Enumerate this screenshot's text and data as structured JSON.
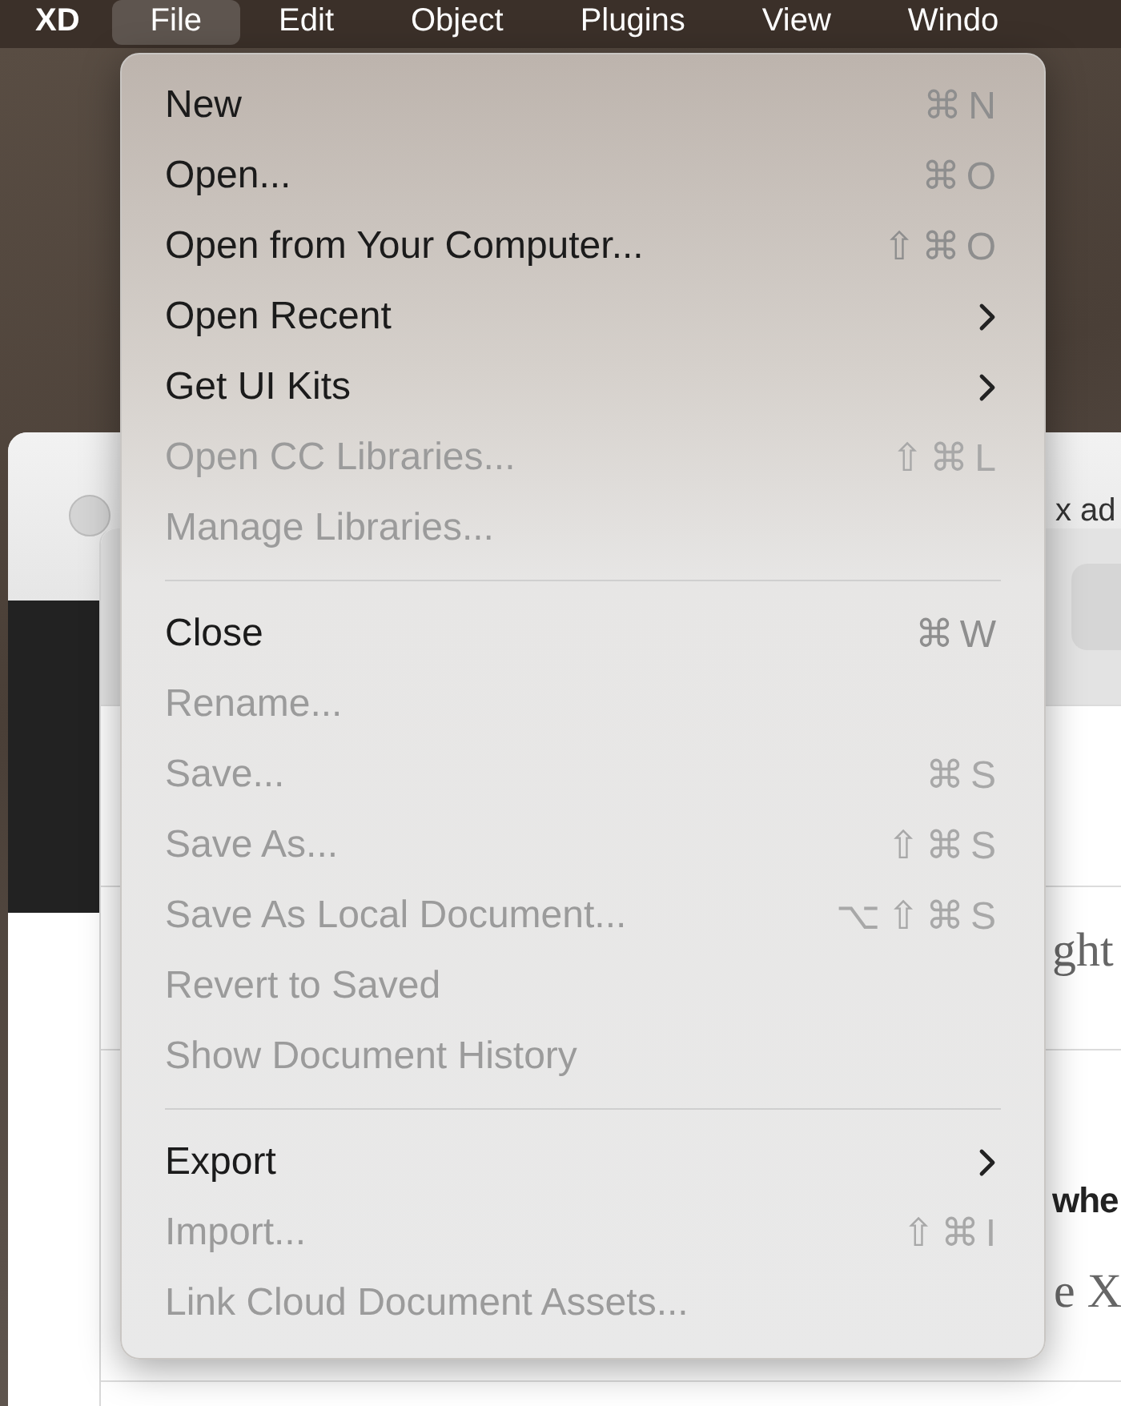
{
  "menu_bar": [
    {
      "label": "XD",
      "selected": false,
      "kind": "app"
    },
    {
      "label": "File",
      "selected": true,
      "kind": "menu"
    },
    {
      "label": "Edit",
      "selected": false,
      "kind": "menu"
    },
    {
      "label": "Object",
      "selected": false,
      "kind": "menu"
    },
    {
      "label": "Plugins",
      "selected": false,
      "kind": "menu"
    },
    {
      "label": "View",
      "selected": false,
      "kind": "menu"
    },
    {
      "label": "Windo",
      "selected": false,
      "kind": "menu"
    }
  ],
  "background_window": {
    "texts": [
      {
        "text": "x ad",
        "kind": "tab"
      },
      {
        "text": "ght",
        "kind": "body"
      },
      {
        "text": "whe",
        "kind": "heading"
      },
      {
        "text": "e X",
        "kind": "body"
      }
    ]
  },
  "file_menu": [
    {
      "kind": "item",
      "label": "New",
      "shortcut": "⌘N",
      "disabled": false
    },
    {
      "kind": "item",
      "label": "Open...",
      "shortcut": "⌘O",
      "disabled": false
    },
    {
      "kind": "item",
      "label": "Open from Your Computer...",
      "shortcut": "⇧⌘O",
      "disabled": false
    },
    {
      "kind": "submenu",
      "label": "Open Recent",
      "disabled": false
    },
    {
      "kind": "submenu",
      "label": "Get UI Kits",
      "disabled": false
    },
    {
      "kind": "item",
      "label": "Open CC Libraries...",
      "shortcut": "⇧⌘L",
      "disabled": true
    },
    {
      "kind": "item",
      "label": "Manage Libraries...",
      "disabled": true
    },
    {
      "kind": "separator"
    },
    {
      "kind": "item",
      "label": "Close",
      "shortcut": "⌘W",
      "disabled": false
    },
    {
      "kind": "item",
      "label": "Rename...",
      "disabled": true
    },
    {
      "kind": "item",
      "label": "Save...",
      "shortcut": "⌘S",
      "disabled": true
    },
    {
      "kind": "item",
      "label": "Save As...",
      "shortcut": "⇧⌘S",
      "disabled": true
    },
    {
      "kind": "item",
      "label": "Save As Local Document...",
      "shortcut": "⌥⇧⌘S",
      "disabled": true
    },
    {
      "kind": "item",
      "label": "Revert to Saved",
      "disabled": true
    },
    {
      "kind": "item",
      "label": "Show Document History",
      "disabled": true
    },
    {
      "kind": "separator"
    },
    {
      "kind": "submenu",
      "label": "Export",
      "disabled": false
    },
    {
      "kind": "item",
      "label": "Import...",
      "shortcut": "⇧⌘I",
      "disabled": true
    },
    {
      "kind": "item",
      "label": "Link Cloud Document Assets...",
      "disabled": true
    }
  ]
}
